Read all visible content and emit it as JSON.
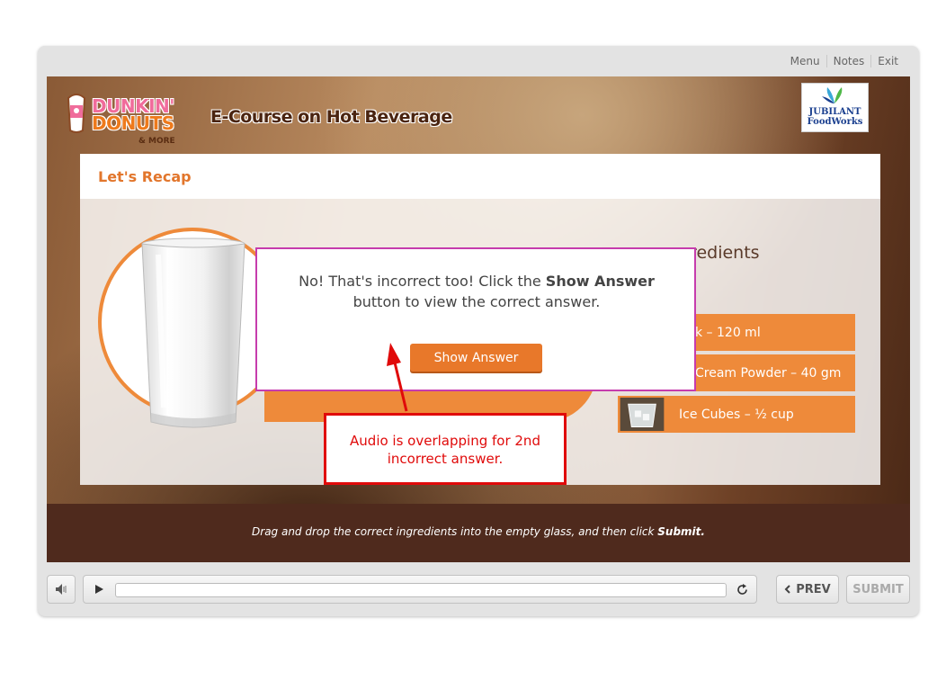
{
  "top_nav": {
    "menu": "Menu",
    "notes": "Notes",
    "exit": "Exit"
  },
  "header": {
    "brand_line1": "DUNKIN'",
    "brand_line2": "DONUTS",
    "brand_more": "& MORE",
    "course_title": "E-Course on Hot Beverage",
    "partner_line1": "JUBILANT",
    "partner_line2": "FoodWorks"
  },
  "recap": {
    "title": "Let's Recap"
  },
  "instruction_tail": "gredients",
  "ingredients": [
    {
      "label": "k – 120 ml"
    },
    {
      "label": "Cream Powder – 40 gm"
    },
    {
      "label": "Ice Cubes – ½ cup"
    }
  ],
  "dialog": {
    "message_before": "No! That's incorrect too! Click the ",
    "message_bold": "Show Answer",
    "message_after": " button to view the correct answer.",
    "button_label": "Show Answer"
  },
  "annotation": {
    "text": "Audio is overlapping for 2nd incorrect answer."
  },
  "footer": {
    "instruction": "Drag and drop the correct ingredients into the empty glass, and then click ",
    "instruction_bold": "Submit."
  },
  "controls": {
    "prev_label": "PREV",
    "submit_label": "SUBMIT"
  },
  "colors": {
    "accent": "#ee8a3a",
    "dialog_border": "#c63cad",
    "annotation": "#e00a0a",
    "footer_bg": "#4f2a1d"
  }
}
